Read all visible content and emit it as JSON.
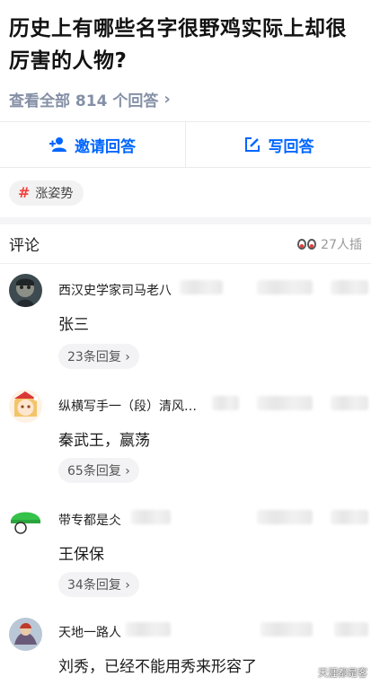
{
  "question": {
    "title": "历史上有哪些名字很野鸡实际上却很厉害的人物?",
    "view_all": "查看全部 814 个回答",
    "chevron": "›"
  },
  "actions": {
    "invite_label": "邀请回答",
    "write_label": "写回答"
  },
  "topic": {
    "hash": "#",
    "label": "涨姿势"
  },
  "comments": {
    "label": "评论",
    "viewers": "27人插",
    "items": [
      {
        "author": "西汉史学家司马老八",
        "text": "张三",
        "replies": "23条回复 ›"
      },
      {
        "author": "纵横写手一（段）清风…",
        "text": "秦武王，嬴荡",
        "replies": "65条回复 ›"
      },
      {
        "author": "带专都是仌",
        "text": "王保保",
        "replies": "34条回复 ›"
      },
      {
        "author": "天地一路人",
        "text": "刘秀，已经不能用秀来形容了",
        "replies": ""
      }
    ]
  },
  "watermark": "天涯都是客",
  "colors": {
    "accent": "#0066ff",
    "topic_hash": "#f1403c",
    "muted": "#8590a6"
  },
  "icons": {
    "invite": "add-user-icon",
    "write": "edit-icon",
    "viewers": "eyes-icon"
  }
}
